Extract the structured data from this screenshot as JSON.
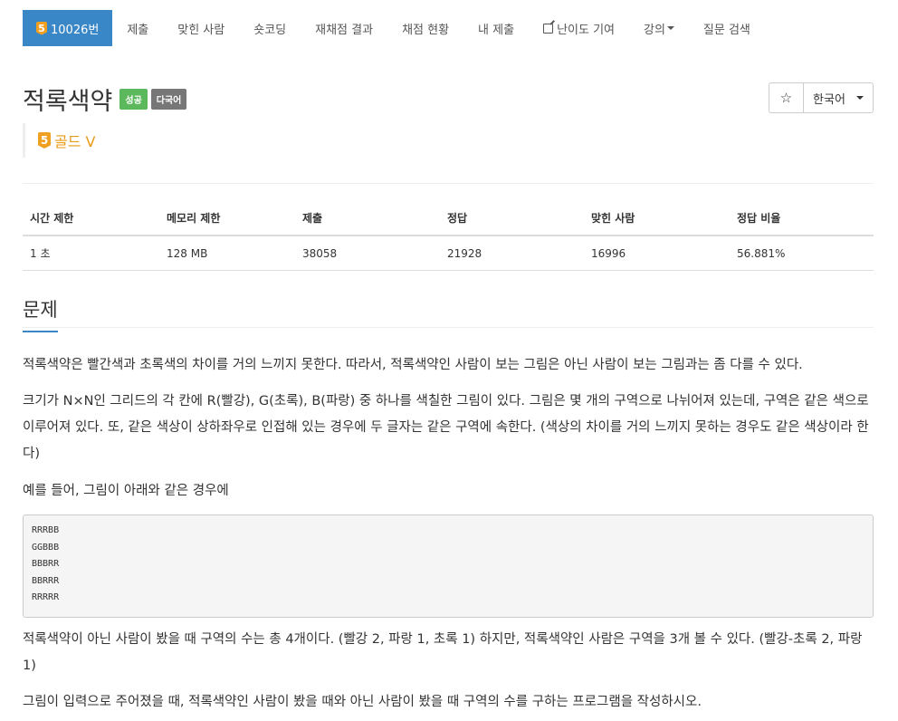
{
  "nav": {
    "problem_id_label": "10026번",
    "problem_tier_num": "5",
    "items": [
      "제출",
      "맞힌 사람",
      "숏코딩",
      "재채점 결과",
      "채점 현황",
      "내 제출",
      "난이도 기여",
      "강의",
      "질문 검색"
    ]
  },
  "header": {
    "title": "적록색약",
    "badge_success": "성공",
    "badge_multi": "다국어",
    "tier_num": "5",
    "tier_label": "골드 V",
    "star_icon": "☆",
    "language": "한국어"
  },
  "info_table": {
    "headers": [
      "시간 제한",
      "메모리 제한",
      "제출",
      "정답",
      "맞힌 사람",
      "정답 비율"
    ],
    "values": [
      "1 초",
      "128 MB",
      "38058",
      "21928",
      "16996",
      "56.881%"
    ]
  },
  "section": {
    "title": "문제",
    "p1": "적록색약은 빨간색과 초록색의 차이를 거의 느끼지 못한다. 따라서, 적록색약인 사람이 보는 그림은 아닌 사람이 보는 그림과는 좀 다를 수 있다.",
    "p2": "크기가 N×N인 그리드의 각 칸에 R(빨강), G(초록), B(파랑) 중 하나를 색칠한 그림이 있다. 그림은 몇 개의 구역으로 나뉘어져 있는데, 구역은 같은 색으로 이루어져 있다. 또, 같은 색상이 상하좌우로 인접해 있는 경우에 두 글자는 같은 구역에 속한다. (색상의 차이를 거의 느끼지 못하는 경우도 같은 색상이라 한다)",
    "p3": "예를 들어, 그림이 아래와 같은 경우에",
    "sample": "RRRBB\nGGBBB\nBBBRR\nBBRRR\nRRRRR",
    "p4": "적록색약이 아닌 사람이 봤을 때 구역의 수는 총 4개이다. (빨강 2, 파랑 1, 초록 1) 하지만, 적록색약인 사람은 구역을 3개 볼 수 있다. (빨강-초록 2, 파랑 1)",
    "p5": "그림이 입력으로 주어졌을 때, 적록색약인 사람이 봤을 때와 아닌 사람이 봤을 때 구역의 수를 구하는 프로그램을 작성하시오."
  },
  "colors": {
    "accent": "#3a87c7",
    "tier_gold": "#e89a16",
    "success": "#5cb85c"
  }
}
